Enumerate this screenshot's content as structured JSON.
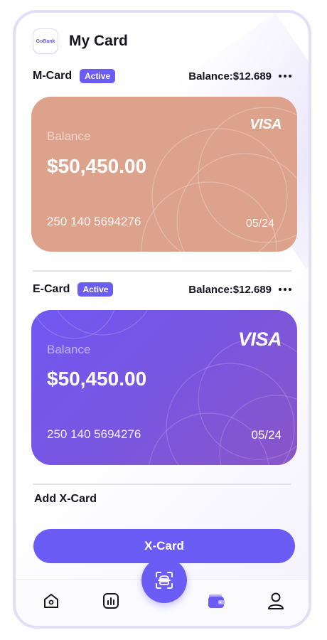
{
  "app": {
    "logo_text": "GoBank",
    "title": "My Card"
  },
  "cards": [
    {
      "name": "M-Card",
      "status": "Active",
      "row_balance": "Balance:$12.689",
      "brand": "VISA",
      "balance_label": "Balance",
      "amount": "$50,450.00",
      "number": "250 140 5694276",
      "expiry": "05/24",
      "color": "#dca28c"
    },
    {
      "name": "E-Card",
      "status": "Active",
      "row_balance": "Balance:$12.689",
      "brand": "VISA",
      "balance_label": "Balance",
      "amount": "$50,450.00",
      "number": "250 140 5694276",
      "expiry": "05/24",
      "color": "#7058f2"
    }
  ],
  "add_section": {
    "title": "Add X-Card",
    "button_label": "X-Card"
  },
  "bottom_nav": {
    "items": [
      {
        "icon": "home-icon",
        "active": false
      },
      {
        "icon": "chart-icon",
        "active": false
      },
      {
        "icon": "scan-icon",
        "active": false
      },
      {
        "icon": "wallet-icon",
        "active": true
      },
      {
        "icon": "profile-icon",
        "active": false
      }
    ]
  },
  "colors": {
    "accent": "#6c5cf6",
    "text": "#16141f",
    "frame": "#e3ddf8"
  }
}
